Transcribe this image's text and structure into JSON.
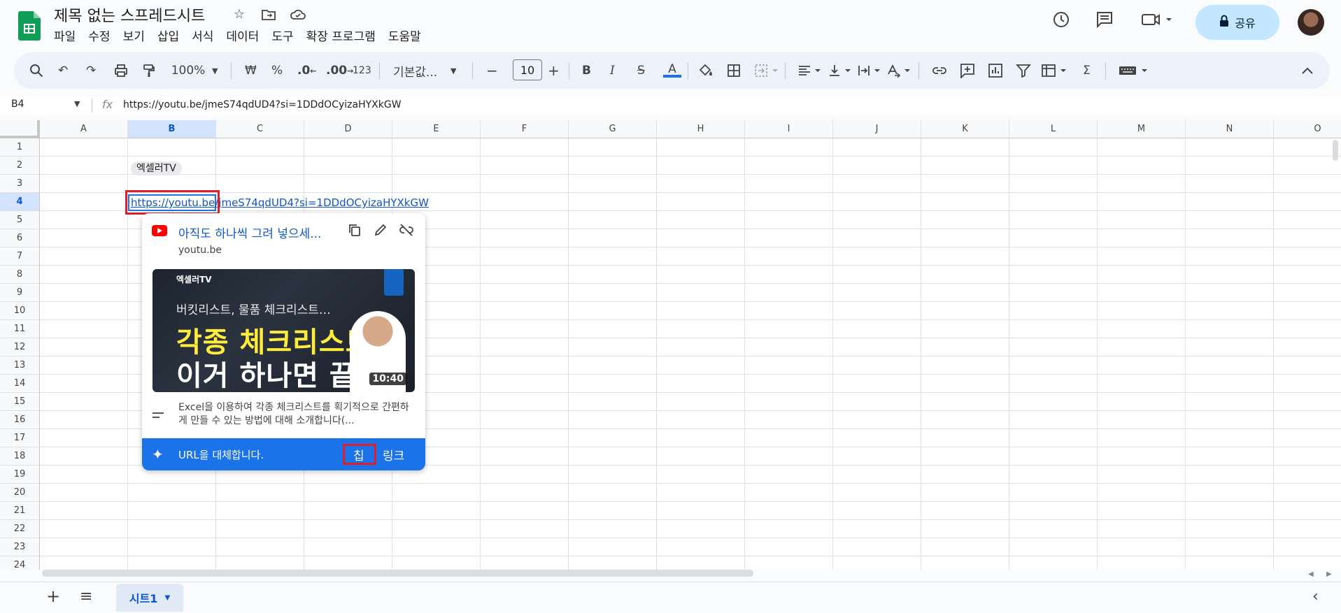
{
  "app": {
    "doc_title": "제목 없는 스프레드시트",
    "menu": [
      "파일",
      "수정",
      "보기",
      "삽입",
      "서식",
      "데이터",
      "도구",
      "확장 프로그램",
      "도움말"
    ],
    "share_label": "공유"
  },
  "toolbar": {
    "zoom": "100%",
    "currency": "₩",
    "percent": "%",
    "decimal_decrease": ".0",
    "decimal_increase": ".00",
    "number_format": "123",
    "font_name": "기본값...",
    "font_size": "10"
  },
  "formula_bar": {
    "name_box": "B4",
    "fx_label": "fx",
    "value": "https://youtu.be/jmeS74qdUD4?si=1DDdOCyizaHYXkGW"
  },
  "grid": {
    "columns": [
      "A",
      "B",
      "C",
      "D",
      "E",
      "F",
      "G",
      "H",
      "I",
      "J",
      "K",
      "L",
      "M",
      "N",
      "O"
    ],
    "rows": [
      "1",
      "2",
      "3",
      "4",
      "5",
      "6",
      "7",
      "8",
      "9",
      "10",
      "11",
      "12",
      "13",
      "14",
      "15",
      "16",
      "17",
      "18",
      "19",
      "20",
      "21",
      "22",
      "23",
      "24"
    ],
    "selected_column": "B",
    "selected_row": "4",
    "cell_b2_chip": "엑셀러TV",
    "cell_b4_link": "https://youtu.be/jmeS74qdUD4?si=1DDdOCyizaHYXkGW"
  },
  "popup": {
    "title": "아직도 하나씩 그려 넣으세...",
    "domain": "youtu.be",
    "thumbnail": {
      "brand": "엑셀러TV",
      "subtitle": "버킷리스트, 물품 체크리스트…",
      "headline_1": "각종 체크리스트,",
      "headline_2": "이거 하나면 끝!",
      "duration": "10:40"
    },
    "description": "Excel을 이용하여 각종 체크리스트를 획기적으로 간편하게 만들 수 있는 방법에 대해 소개합니다(...",
    "replace_text": "URL을 대체합니다.",
    "chip_button": "칩",
    "link_button": "링크"
  },
  "sheets": {
    "active_tab": "시트1"
  },
  "colors": {
    "accent": "#1a73e8",
    "link": "#1155cc",
    "share_bg": "#c2e7ff",
    "highlight": "#e01e2b"
  }
}
